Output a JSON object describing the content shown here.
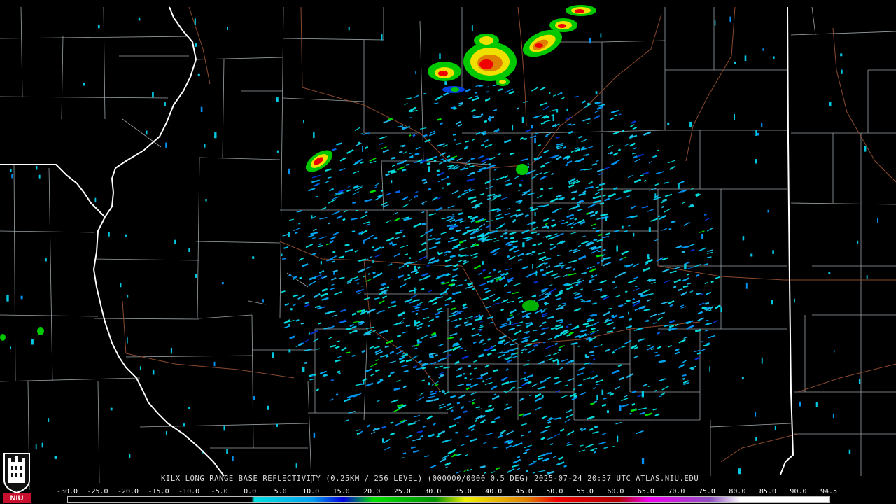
{
  "product": {
    "title": "KILX LONG RANGE BASE REFLECTIVITY (0.25KM / 256 LEVEL) (000000/0000 0.5 DEG) 2025-07-24 20:57 UTC  ATLAS.NIU.EDU",
    "radar_site": "KILX",
    "elevation": "0.5 DEG",
    "timestamp": "2025-07-24 20:57 UTC",
    "source": "ATLAS.NIU.EDU"
  },
  "logo": {
    "text": "NIU",
    "icon": "niu-castle-icon",
    "color": "#c8102e"
  },
  "colors": {
    "background": "#000000",
    "state_border": "#ffffff",
    "county_border": "#9aa3a8",
    "highway": "#8b4a2e"
  },
  "color_scale": {
    "labels": [
      "-30.0",
      "-25.0",
      "-20.0",
      "-15.0",
      "-10.0",
      "-5.0",
      "0.0",
      "5.0",
      "10.0",
      "15.0",
      "20.0",
      "25.0",
      "30.0",
      "35.0",
      "40.0",
      "45.0",
      "50.0",
      "55.0",
      "60.0",
      "65.0",
      "70.0",
      "75.0",
      "80.0",
      "85.0",
      "90.0",
      "94.5"
    ],
    "stops": [
      {
        "dbz": -30,
        "color": "#000000"
      },
      {
        "dbz": 0,
        "color": "#000000"
      },
      {
        "dbz": 0.5,
        "color": "#00e0e0"
      },
      {
        "dbz": 10,
        "color": "#00a0f0"
      },
      {
        "dbz": 15,
        "color": "#0000e0"
      },
      {
        "dbz": 20,
        "color": "#00e000"
      },
      {
        "dbz": 30,
        "color": "#009000"
      },
      {
        "dbz": 35,
        "color": "#f0f000"
      },
      {
        "dbz": 45,
        "color": "#e08000"
      },
      {
        "dbz": 50,
        "color": "#f00000"
      },
      {
        "dbz": 60,
        "color": "#b00000"
      },
      {
        "dbz": 65,
        "color": "#f000f0"
      },
      {
        "dbz": 75,
        "color": "#9050c0"
      },
      {
        "dbz": 80,
        "color": "#ffffff"
      },
      {
        "dbz": 94.5,
        "color": "#ffffff"
      }
    ]
  }
}
